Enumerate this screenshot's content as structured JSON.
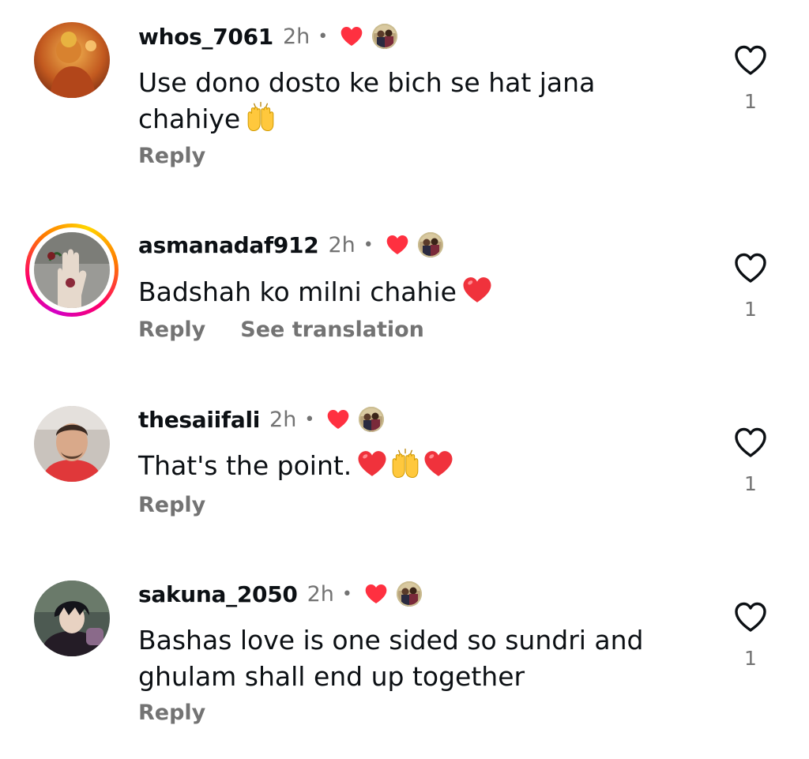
{
  "comments": [
    {
      "username": "whos_7061",
      "time": "2h",
      "separator": "•",
      "text": "Use dono dosto ke bich se hat jana\nchahiye",
      "emoji": [
        "raised-hands"
      ],
      "reply_label": "Reply",
      "like_count": "1"
    },
    {
      "username": "asmanadaf912",
      "time": "2h",
      "separator": "•",
      "text": "Badshah ko milni  chahie",
      "emoji": [
        "red-heart"
      ],
      "reply_label": "Reply",
      "translate_label": "See translation",
      "like_count": "1",
      "has_story_ring": true
    },
    {
      "username": "thesaiifali",
      "time": "2h",
      "separator": "•",
      "text": "That's the point.",
      "emoji": [
        "red-heart",
        "raised-hands",
        "red-heart"
      ],
      "reply_label": "Reply",
      "like_count": "1"
    },
    {
      "username": "sakuna_2050",
      "time": "2h",
      "separator": "•",
      "text": "Bashas love is one sided so sundri and\nghulam shall end up together",
      "emoji": [],
      "reply_label": "Reply",
      "like_count": "1"
    }
  ],
  "colors": {
    "primary_text": "#0c1014",
    "secondary_text": "#737373",
    "heart_red": "#ff3040",
    "outline_icon": "#0c1014"
  },
  "icons": {
    "like": "heart-outline-icon",
    "liked_by_author": "red-heart-icon",
    "author_avatar": "author-avatar-icon"
  }
}
